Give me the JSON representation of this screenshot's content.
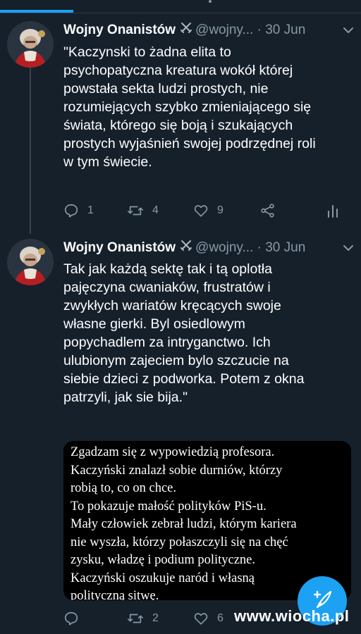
{
  "tweets": [
    {
      "display_name": "Wojny Onanistów",
      "handle": "@wojny...",
      "separator": "·",
      "date": "30 Jun",
      "text": "\"Kaczynski to żadna elita to\npsychopatyczna kreatura wokół której\npowstała sekta ludzi prostych, nie\nrozumiejących szybko zmieniającego się\nświata, którego się boją i szukających\nprostych wyjaśnień swojej podrzędnej roli\nw tym świecie.",
      "replies": "1",
      "retweets": "4",
      "likes": "9"
    },
    {
      "display_name": "Wojny Onanistów",
      "handle": "@wojny...",
      "separator": "·",
      "date": "30 Jun",
      "text": "Tak jak każdą sektę tak i tą oplotła\npajęczyna cwaniaków, frustratów i\nzwykłych wariatów kręcących swoje\nwłasne gierki. Byl osiedlowym\npopychadlem za intryganctwo. Ich\nulubionym zajeciem bylo szczucie na\nsiebie dzieci z podworka. Potem z okna\npatrzyli, jak sie bija.\"",
      "image_text": "Zgadzam się z wypowiedzią profesora.\nKaczyński znalazł sobie durniów, którzy\nrobią to, co on chce.\nTo pokazuje małość polityków PiS-u.\nMały człowiek zebrał ludzi, którym kariera\nnie wyszła, którzy połaszczyli się na chęć\nzysku, władzę i podium polityczne.\nKaczyński oszukuje naród i własną\npolityczną sitwę.",
      "replies": "",
      "retweets": "2",
      "likes": "6"
    }
  ],
  "watermark": "www.wiocha.pl",
  "colors": {
    "background": "#15202b",
    "accent": "#1da1f2",
    "secondary_text": "#8899a6"
  },
  "icons": [
    "reply-icon",
    "retweet-icon",
    "like-icon",
    "share-icon",
    "analytics-icon",
    "compose-icon",
    "crossed-swords-icon",
    "chevron-down-icon"
  ]
}
